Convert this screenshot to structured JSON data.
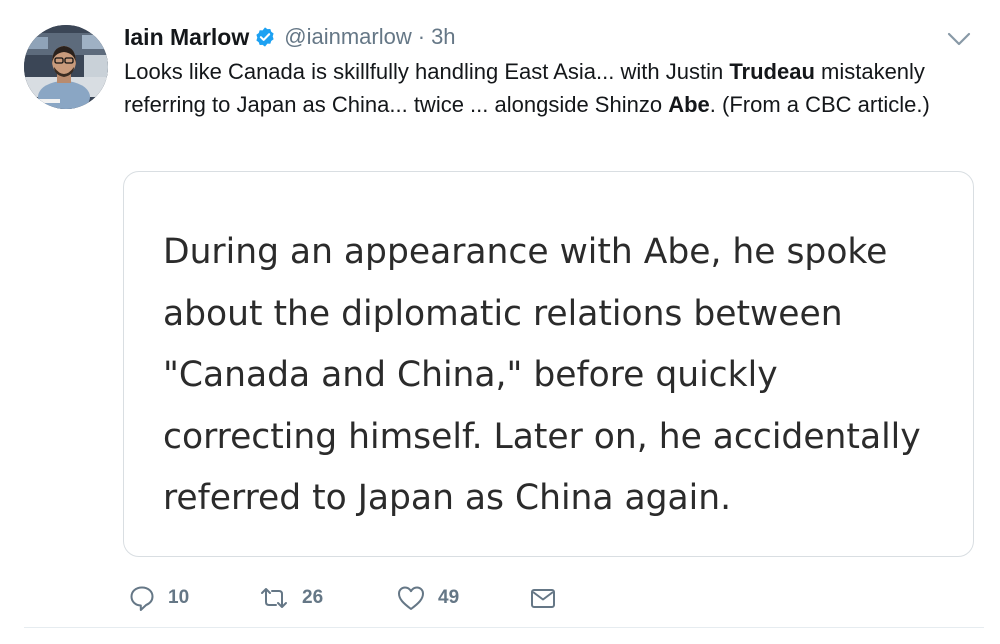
{
  "tweet": {
    "author_name": "Iain Marlow",
    "handle": "@iainmarlow",
    "separator": "·",
    "time": "3h",
    "text_parts": [
      "Looks like Canada is skillfully handling East Asia... with Justin ",
      "Trudeau",
      " mistakenly referring to Japan as China... twice ... alongside Shinzo ",
      "Abe",
      ". (From a CBC article.)"
    ],
    "quote_lines": [
      "During an appearance with Abe, he spoke",
      "about the diplomatic relations between",
      "\"Canada and China,\" before quickly",
      "correcting himself. Later on, he accidentally",
      "referred to Japan as China again."
    ]
  },
  "actions": {
    "reply_count": "10",
    "retweet_count": "26",
    "like_count": "49"
  },
  "icons": {
    "verified": "verified-badge-icon",
    "caret": "chevron-down-icon",
    "reply": "reply-icon",
    "retweet": "retweet-icon",
    "like": "heart-icon",
    "message": "envelope-icon"
  },
  "colors": {
    "verified_blue": "#1da1f2",
    "secondary_text": "#657786",
    "card_border": "#d9dee2"
  }
}
